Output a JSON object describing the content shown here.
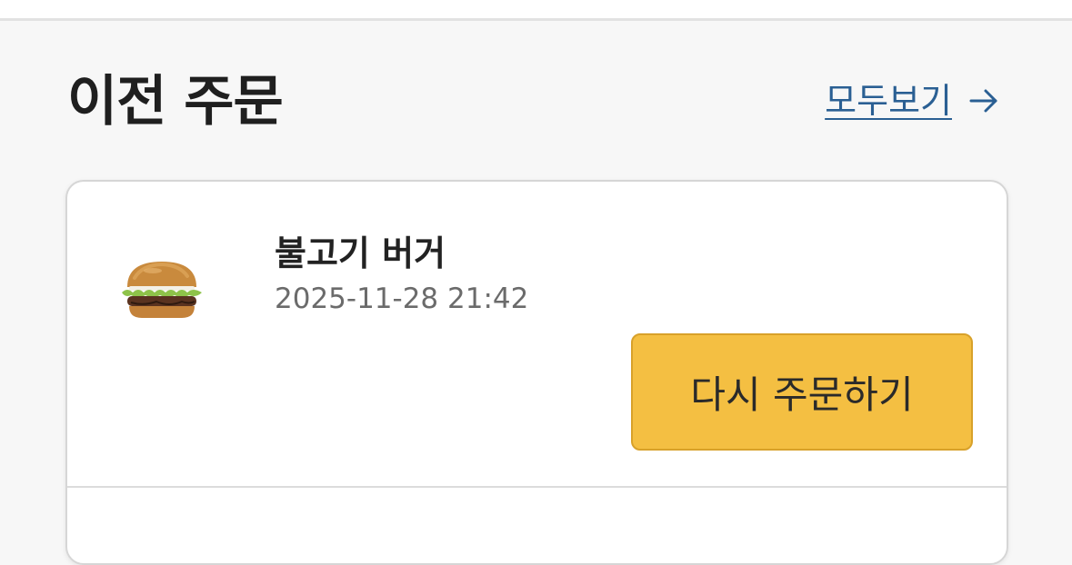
{
  "section": {
    "title": "이전 주문",
    "view_all_label": "모두보기",
    "view_all_icon": "arrow-right-icon",
    "link_color": "#2a5f93"
  },
  "order": {
    "image_icon": "bulgogi-burger-image",
    "name": "불고기 버거",
    "datetime": "2025-11-28 21:42",
    "reorder_label": "다시 주문하기",
    "reorder_color": "#f4bf42"
  }
}
